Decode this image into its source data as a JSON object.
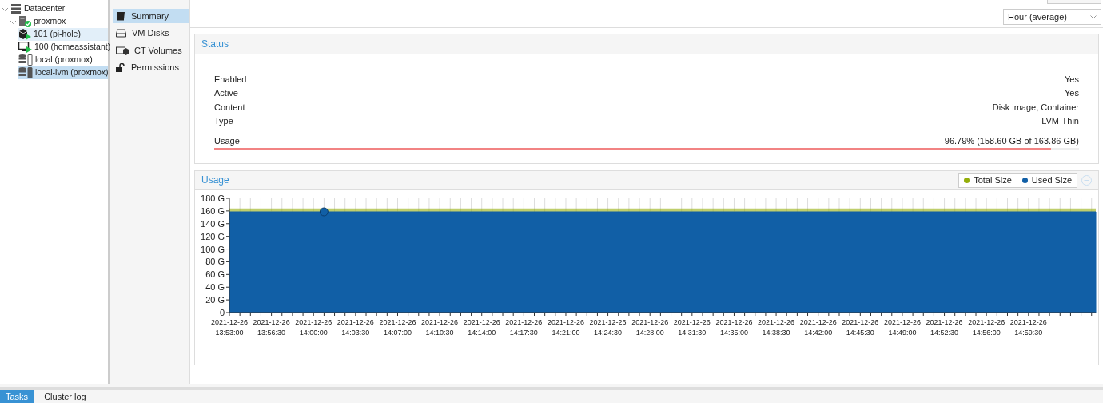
{
  "tree": [
    {
      "label": "Datacenter",
      "kind": "datacenter",
      "selected": false,
      "hovered": false,
      "expanded": true,
      "children": [
        {
          "label": "proxmox",
          "kind": "node",
          "selected": false,
          "hovered": false,
          "expanded": true,
          "children": [
            {
              "label": "101 (pi-hole)",
              "kind": "container",
              "selected": false,
              "hovered": true
            },
            {
              "label": "100 (homeassistant)",
              "kind": "vm",
              "selected": false,
              "hovered": false
            },
            {
              "label": "local (proxmox)",
              "kind": "storage",
              "selected": false,
              "hovered": false
            },
            {
              "label": "local-lvm (proxmox)",
              "kind": "storage-lvm",
              "selected": true,
              "hovered": false
            }
          ]
        }
      ]
    }
  ],
  "menu": [
    {
      "label": "Summary",
      "kind": "summary",
      "selected": true
    },
    {
      "label": "VM Disks",
      "kind": "disks",
      "selected": false
    },
    {
      "label": "CT Volumes",
      "kind": "volumes",
      "selected": false
    },
    {
      "label": "Permissions",
      "kind": "permissions",
      "selected": false
    }
  ],
  "timeframe": {
    "value": "Hour (average)"
  },
  "status": {
    "title": "Status",
    "rows": [
      {
        "label": "Enabled",
        "value": "Yes"
      },
      {
        "label": "Active",
        "value": "Yes"
      },
      {
        "label": "Content",
        "value": "Disk image, Container"
      },
      {
        "label": "Type",
        "value": "LVM-Thin"
      }
    ],
    "usage": {
      "label": "Usage",
      "reading": "96.79% (158.60 GB of 163.86 GB)",
      "level": 0.9679
    }
  },
  "usage_panel": {
    "title": "Usage",
    "chart_data": {
      "type": "area",
      "grid": true,
      "ylim": [
        0,
        180
      ],
      "yticks": [
        {
          "value": 0,
          "label": "0"
        },
        {
          "value": 20,
          "label": "20 G"
        },
        {
          "value": 40,
          "label": "40 G"
        },
        {
          "value": 60,
          "label": "60 G"
        },
        {
          "value": 80,
          "label": "80 G"
        },
        {
          "value": 100,
          "label": "100 G"
        },
        {
          "value": 120,
          "label": "120 G"
        },
        {
          "value": 140,
          "label": "140 G"
        },
        {
          "value": 160,
          "label": "160 G"
        },
        {
          "value": 180,
          "label": "180 G"
        }
      ],
      "categories": [
        "2021-12-26 13:53:00",
        "2021-12-26 13:56:30",
        "2021-12-26 14:00:00",
        "2021-12-26 14:03:30",
        "2021-12-26 14:07:00",
        "2021-12-26 14:10:30",
        "2021-12-26 14:14:00",
        "2021-12-26 14:17:30",
        "2021-12-26 14:21:00",
        "2021-12-26 14:24:30",
        "2021-12-26 14:28:00",
        "2021-12-26 14:31:30",
        "2021-12-26 14:35:00",
        "2021-12-26 14:38:30",
        "2021-12-26 14:42:00",
        "2021-12-26 14:45:30",
        "2021-12-26 14:49:00",
        "2021-12-26 14:52:30",
        "2021-12-26 14:56:00",
        "2021-12-26 14:59:30"
      ],
      "series": [
        {
          "name": "Total Size",
          "color": "#94ae0a",
          "values": [
            163.86,
            163.86,
            163.86,
            163.86,
            163.86,
            163.86,
            163.86,
            163.86,
            163.86,
            163.86,
            163.86,
            163.86,
            163.86,
            163.86,
            163.86,
            163.86,
            163.86,
            163.86,
            163.86,
            163.86
          ]
        },
        {
          "name": "Used Size",
          "color": "#115fa6",
          "values": [
            158.6,
            158.6,
            158.6,
            158.6,
            158.6,
            158.6,
            158.6,
            158.6,
            158.6,
            158.6,
            158.6,
            158.6,
            158.6,
            158.6,
            158.6,
            158.6,
            158.6,
            158.6,
            158.6,
            158.6
          ]
        }
      ]
    }
  },
  "bottom_tabs": [
    {
      "label": "Tasks",
      "selected": true
    },
    {
      "label": "Cluster log",
      "selected": false
    }
  ]
}
